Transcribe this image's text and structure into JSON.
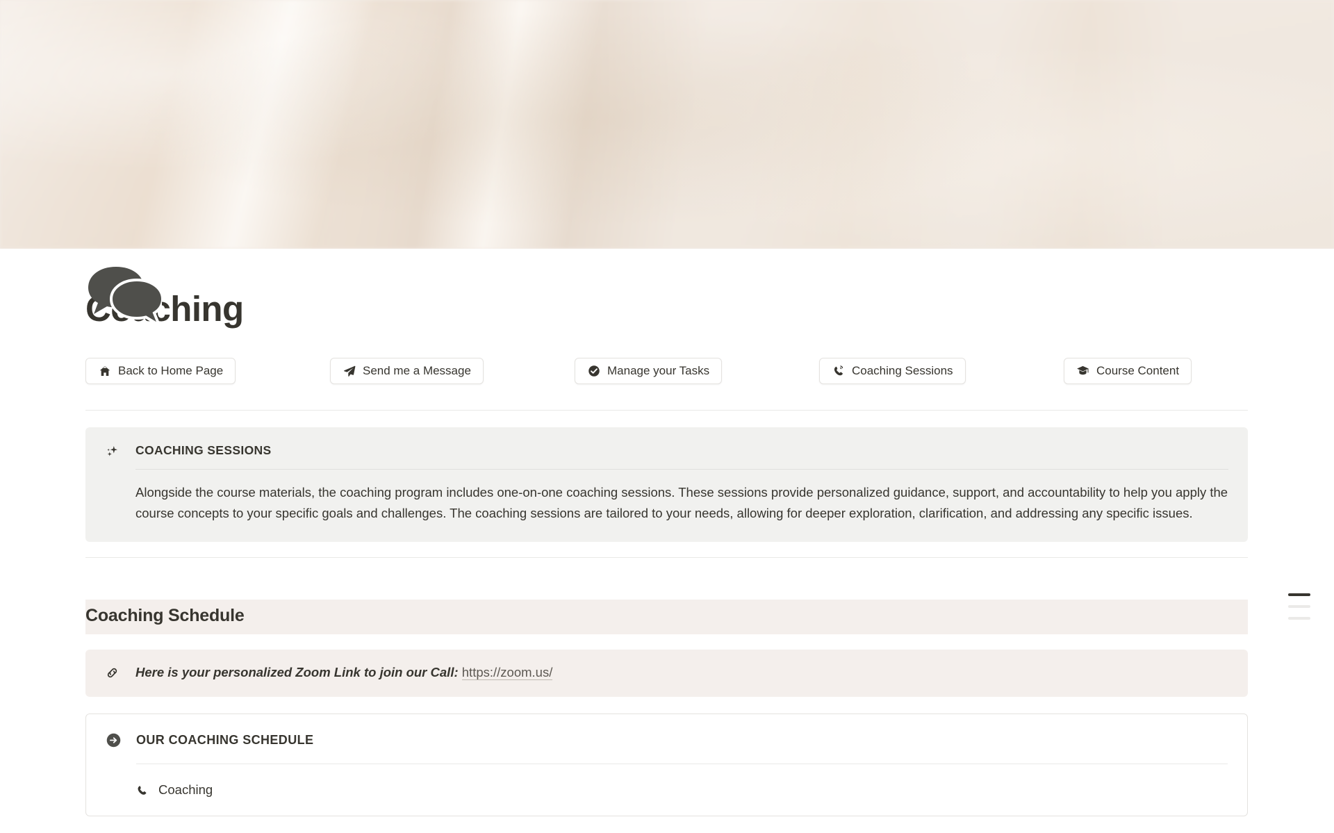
{
  "page": {
    "title": "Coaching",
    "icon": "speech-bubbles-icon"
  },
  "cover": {
    "type": "abstract-blurred-photo",
    "base_color": "#F1E9E1",
    "accent_color": "#E7D6C4"
  },
  "nav": {
    "buttons": [
      {
        "label": "Back to Home Page",
        "icon": "home-icon"
      },
      {
        "label": "Send me a Message",
        "icon": "paper-plane-icon"
      },
      {
        "label": "Manage your Tasks",
        "icon": "check-circle-icon"
      },
      {
        "label": "Coaching Sessions",
        "icon": "phone-ringing-icon"
      },
      {
        "label": "Course Content",
        "icon": "graduation-cap-icon"
      }
    ]
  },
  "callout_sessions": {
    "icon": "sparkles-icon",
    "title": "COACHING SESSIONS",
    "body": "Alongside the course materials, the coaching program includes one-on-one coaching sessions. These sessions provide personalized guidance, support, and accountability to help you apply the course concepts to your specific goals and challenges. The coaching sessions are tailored to your needs, allowing for deeper exploration, clarification, and addressing any specific issues.",
    "background_color": "#F1F1EF"
  },
  "schedule_section": {
    "heading": "Coaching Schedule",
    "heading_background_color": "#F4EFEC"
  },
  "callout_zoom": {
    "icon": "link-icon",
    "text": "Here is your personalized Zoom Link to join our Call:",
    "link_text": "https://zoom.us/",
    "background_color": "#F4EFEC"
  },
  "schedule_card": {
    "icon": "arrow-right-circle-icon",
    "title": "OUR COACHING SCHEDULE",
    "items": [
      {
        "label": "Coaching",
        "icon": "phone-icon"
      }
    ]
  },
  "toc": {
    "bars": [
      {
        "state": "active"
      },
      {
        "state": "dim"
      },
      {
        "state": "dim"
      }
    ]
  }
}
